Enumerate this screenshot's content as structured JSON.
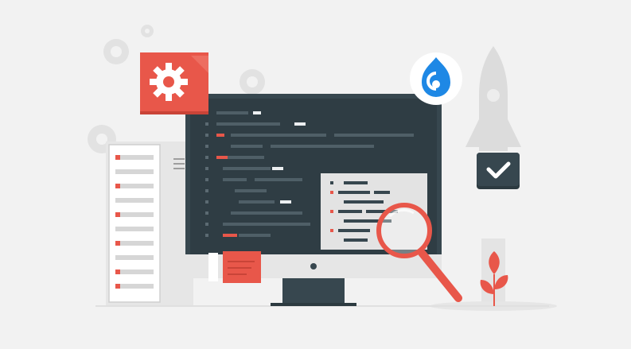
{
  "scene": {
    "description_colors": {
      "background": "#f2f2f2",
      "monitor_dark": "#37474f",
      "accent_red": "#e8574a",
      "light_grey": "#d9d9d9",
      "mid_grey": "#bdbdbd",
      "drupal_blue": "#1e88e5"
    },
    "icons": [
      "gear-icon",
      "drupal-logo-icon",
      "checkmark-icon",
      "magnifier-icon",
      "rocket-icon",
      "plant-icon",
      "document-icon"
    ]
  }
}
